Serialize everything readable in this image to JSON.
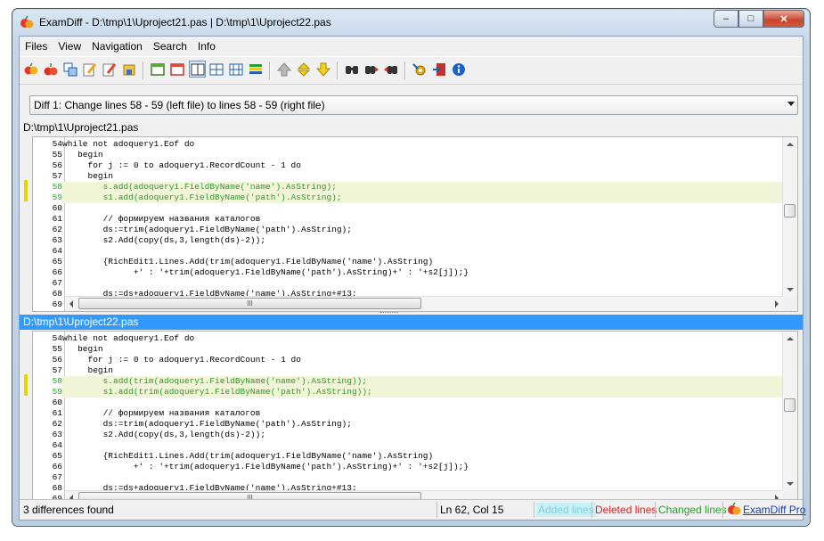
{
  "window": {
    "title": "ExamDiff - D:\\tmp\\1\\Uproject21.pas  |  D:\\tmp\\1\\Uproject22.pas",
    "min_glyph": "–",
    "max_glyph": "□",
    "close_glyph": "✕"
  },
  "menu": [
    "Files",
    "View",
    "Navigation",
    "Search",
    "Info"
  ],
  "toolbar": {
    "icons": [
      "open-files-icon",
      "reopen-icon",
      "compare-dirs-icon",
      "edit-left-icon",
      "edit-right-icon",
      "save-icon",
      "show-left-pane-icon",
      "show-right-pane-icon",
      "split-horizontal-icon",
      "split-vertical-icon",
      "split-both-icon",
      "color-bars-icon",
      "first-diff-icon",
      "prev-diff-icon",
      "next-diff-icon",
      "find-icon",
      "find-next-icon",
      "find-prev-icon",
      "options-icon",
      "exit-icon",
      "about-icon"
    ],
    "pressed": "split-horizontal-icon"
  },
  "diff_selector": {
    "value": "Diff 1: Change lines 58 - 59 (left file) to lines 58 - 59 (right file)"
  },
  "left_pane": {
    "title": "D:\\tmp\\1\\Uproject21.pas",
    "lines": [
      {
        "n": "54",
        "text": "while not adoquery1.Eof do",
        "changed": false
      },
      {
        "n": "55",
        "text": "   begin",
        "changed": false
      },
      {
        "n": "56",
        "text": "     for j := 0 to adoquery1.RecordCount - 1 do",
        "changed": false
      },
      {
        "n": "57",
        "text": "     begin",
        "changed": false
      },
      {
        "n": "58",
        "text": "        s.add(adoquery1.FieldByName('name').AsString);",
        "changed": true
      },
      {
        "n": "59",
        "text": "        s1.add(adoquery1.FieldByName('path').AsString);",
        "changed": true
      },
      {
        "n": "60",
        "text": "",
        "changed": false
      },
      {
        "n": "61",
        "text": "        // формируем названия каталогов",
        "changed": false
      },
      {
        "n": "62",
        "text": "        ds:=trim(adoquery1.FieldByName('path').AsString);",
        "changed": false
      },
      {
        "n": "63",
        "text": "        s2.Add(copy(ds,3,length(ds)-2));",
        "changed": false
      },
      {
        "n": "64",
        "text": "",
        "changed": false
      },
      {
        "n": "65",
        "text": "        {RichEdit1.Lines.Add(trim(adoquery1.FieldByName('name').AsString)",
        "changed": false
      },
      {
        "n": "66",
        "text": "              +' : '+trim(adoquery1.FieldByName('path').AsString)+' : '+s2[j]);}",
        "changed": false
      },
      {
        "n": "67",
        "text": "",
        "changed": false
      },
      {
        "n": "68",
        "text": "        ds:=ds+adoquery1.FieldByName('name').AsString+#13;",
        "changed": false
      },
      {
        "n": "69",
        "text": "",
        "changed": false
      }
    ]
  },
  "right_pane": {
    "title": "D:\\tmp\\1\\Uproject22.pas",
    "lines": [
      {
        "n": "54",
        "text": "while not adoquery1.Eof do",
        "changed": false
      },
      {
        "n": "55",
        "text": "   begin",
        "changed": false
      },
      {
        "n": "56",
        "text": "     for j := 0 to adoquery1.RecordCount - 1 do",
        "changed": false
      },
      {
        "n": "57",
        "text": "     begin",
        "changed": false
      },
      {
        "n": "58",
        "text": "        s.add(trim(adoquery1.FieldByName('name').AsString));",
        "changed": true
      },
      {
        "n": "59",
        "text": "        s1.add(trim(adoquery1.FieldByName('path').AsString));",
        "changed": true
      },
      {
        "n": "60",
        "text": "",
        "changed": false
      },
      {
        "n": "61",
        "text": "        // формируем названия каталогов",
        "changed": false
      },
      {
        "n": "62",
        "text": "        ds:=trim(adoquery1.FieldByName('path').AsString);",
        "changed": false
      },
      {
        "n": "63",
        "text": "        s2.Add(copy(ds,3,length(ds)-2));",
        "changed": false
      },
      {
        "n": "64",
        "text": "",
        "changed": false
      },
      {
        "n": "65",
        "text": "        {RichEdit1.Lines.Add(trim(adoquery1.FieldByName('name').AsString)",
        "changed": false
      },
      {
        "n": "66",
        "text": "              +' : '+trim(adoquery1.FieldByName('path').AsString)+' : '+s2[j]);}",
        "changed": false
      },
      {
        "n": "67",
        "text": "",
        "changed": false
      },
      {
        "n": "68",
        "text": "        ds:=ds+adoquery1.FieldByName('name').AsString+#13;",
        "changed": false
      },
      {
        "n": "69",
        "text": "",
        "changed": false
      }
    ]
  },
  "hscroll_grip": "III",
  "status": {
    "differences": "3 differences found",
    "cursor": "Ln 62, Col 15",
    "legend_added": "Added lines",
    "legend_deleted": "Deleted lines",
    "legend_changed": "Changed lines",
    "pro_link": "ExamDiff Pro"
  },
  "colors": {
    "changed_text": "#2c9b2c",
    "changed_background": "#f0f5d8",
    "diff_marker": "#e8d200",
    "active_pane_title": "#3399ff",
    "deleted_text": "#e02020"
  }
}
